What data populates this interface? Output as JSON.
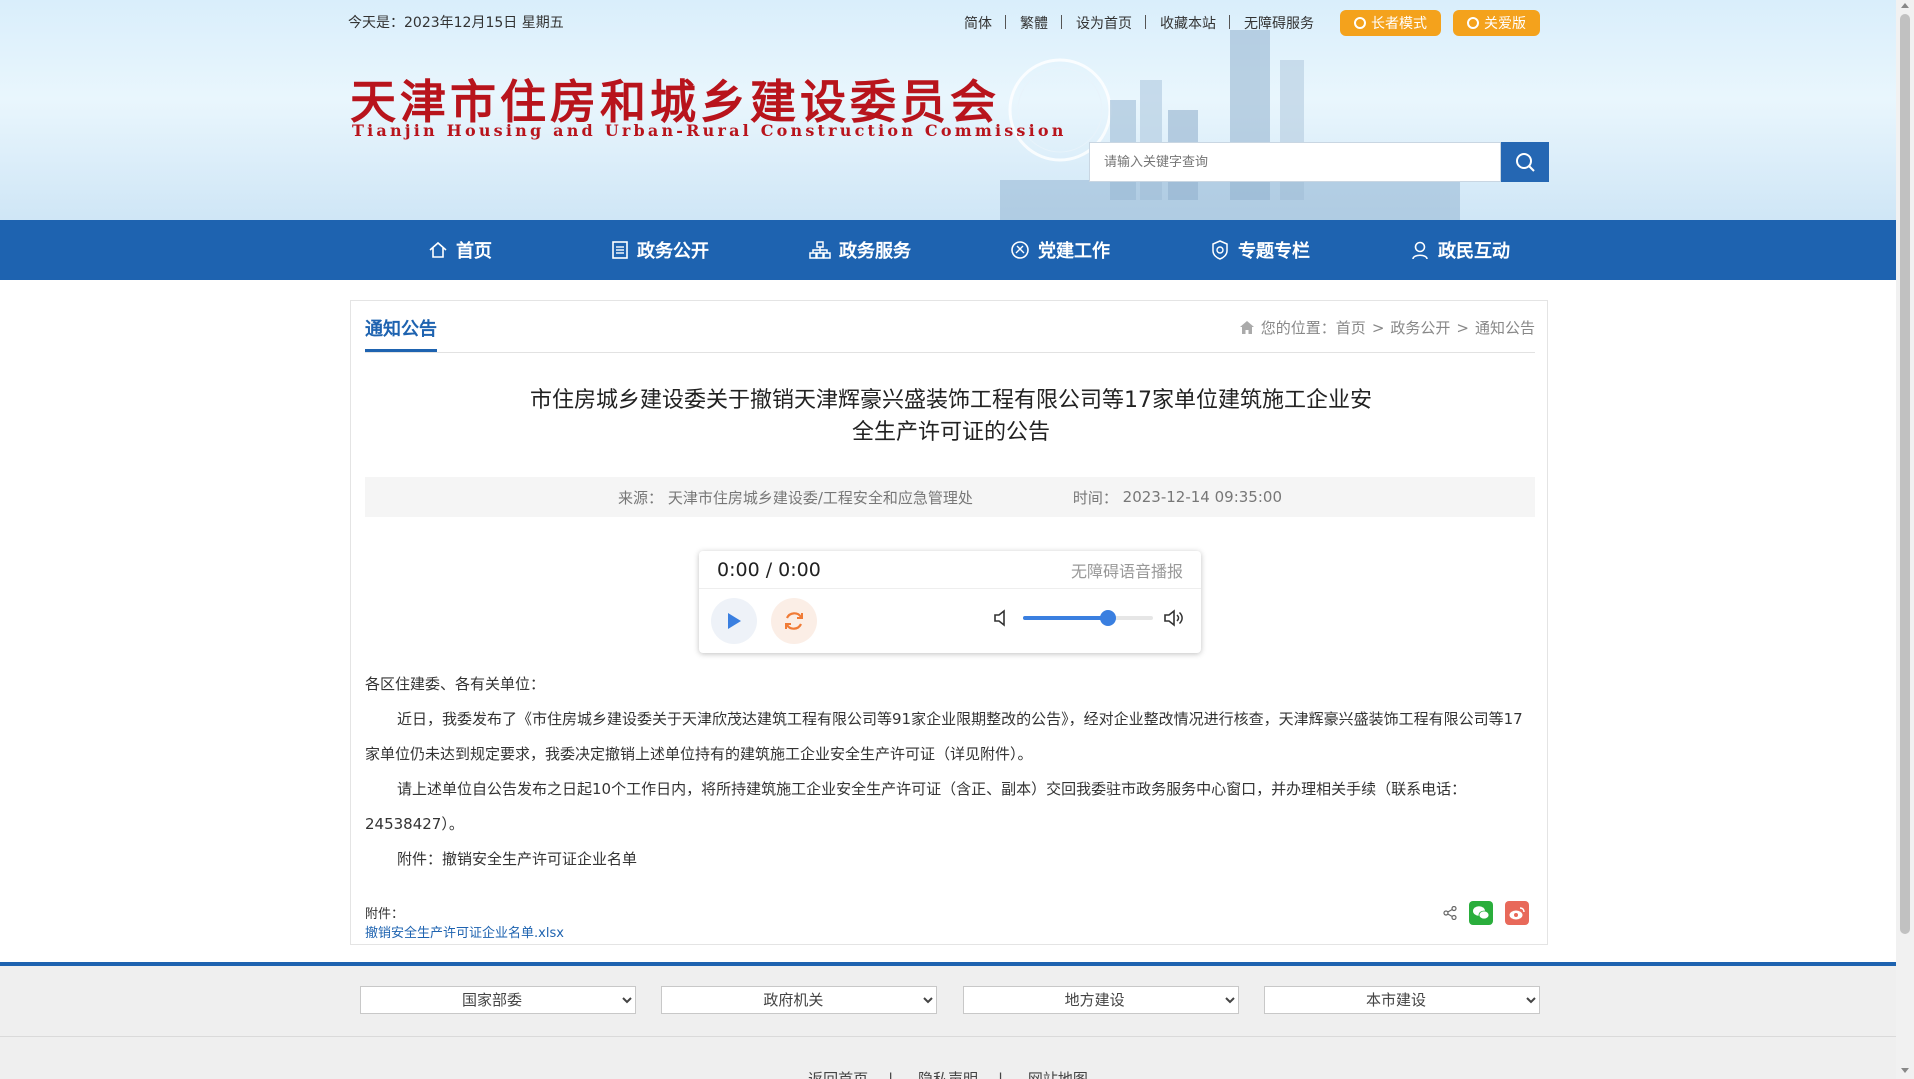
{
  "topbar": {
    "date": "今天是：2023年12月15日 星期五",
    "links": [
      "简体",
      "繁體",
      "设为首页",
      "收藏本站",
      "无障碍服务"
    ],
    "elder_mode": "长者模式",
    "care_version": "关爱版"
  },
  "brand": {
    "name_cn": "天津市住房和城乡建设委员会",
    "name_en": "Tianjin Housing and Urban-Rural Construction Commission"
  },
  "search": {
    "placeholder": "请输入关键字查询"
  },
  "nav": {
    "items": [
      {
        "label": "首页",
        "icon": "home-icon"
      },
      {
        "label": "政务公开",
        "icon": "document-icon"
      },
      {
        "label": "政务服务",
        "icon": "org-chart-icon"
      },
      {
        "label": "党建工作",
        "icon": "party-icon"
      },
      {
        "label": "专题专栏",
        "icon": "badge-icon"
      },
      {
        "label": "政民互动",
        "icon": "user-icon"
      }
    ]
  },
  "section": {
    "title": "通知公告",
    "crumb_prefix": "您的位置：",
    "crumbs": [
      "首页",
      "政务公开",
      "通知公告"
    ],
    "crumb_sep": ">"
  },
  "article": {
    "title_line1": "市住房城乡建设委关于撤销天津辉豪兴盛装饰工程有限公司等17家单位建筑施工企业安",
    "title_line2": "全生产许可证的公告",
    "source_label": "来源：",
    "source": "天津市住房城乡建设委/工程安全和应急管理处",
    "time_label": "时间：",
    "time": "2023-12-14 09:35:00",
    "greeting": "各区住建委、各有关单位：",
    "para1": "近日，我委发布了《市住房城乡建设委关于天津欣茂达建筑工程有限公司等91家企业限期整改的公告》，经对企业整改情况进行核查，天津辉豪兴盛装饰工程有限公司等17家单位仍未达到规定要求，我委决定撤销上述单位持有的建筑施工企业安全生产许可证（详见附件）。",
    "para2": "请上述单位自公告发布之日起10个工作日内，将所持建筑施工企业安全生产许可证（含正、副本）交回我委驻市政务服务中心窗口，并办理相关手续（联系电话：24538427）。",
    "para3": "附件：撤销安全生产许可证企业名单",
    "attach_label": "附件：",
    "attach_file": "撤销安全生产许可证企业名单.xlsx"
  },
  "player": {
    "time": "0:00 / 0:00",
    "label": "无障碍语音播报",
    "volume": 0.65
  },
  "footer": {
    "selects": [
      "国家部委",
      "政府机关",
      "地方建设",
      "本市建设"
    ],
    "links": [
      "返回首页",
      "隐私声明",
      "网站地图"
    ]
  },
  "colors": {
    "brand_blue": "#1e63b0",
    "logo_red": "#b8141c",
    "pill_orange": "#f4a21c"
  }
}
